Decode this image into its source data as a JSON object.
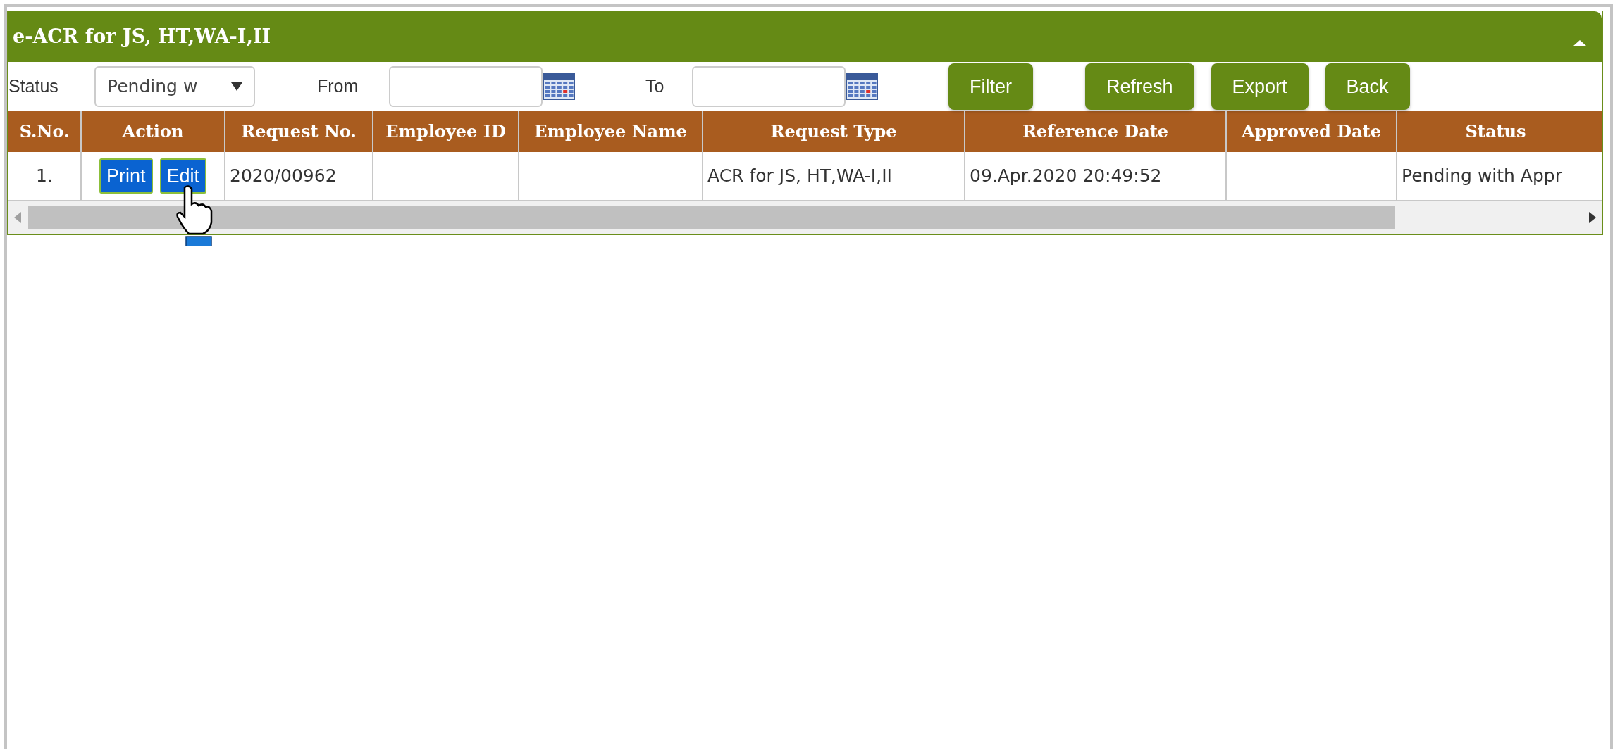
{
  "panel": {
    "title": "e-ACR for JS, HT,WA-I,II"
  },
  "filters": {
    "status_label": "Status",
    "status_value": "Pending w",
    "from_label": "From",
    "to_label": "To"
  },
  "buttons": [
    "Filter",
    "Refresh",
    "Export",
    "Back"
  ],
  "table": {
    "columns": [
      "S.No.",
      "Action",
      "Request No.",
      "Employee ID",
      "Employee Name",
      "Request Type",
      "Reference Date",
      "Approved Date",
      "Status"
    ],
    "rows": [
      {
        "sno": "1.",
        "actions": [
          "Print",
          "Edit"
        ],
        "request_no": "2020/00962",
        "employee_id": "",
        "employee_name": "",
        "request_type": "ACR for JS, HT,WA-I,II",
        "reference_date": "09.Apr.2020 20:49:52",
        "approved_date": "",
        "status": "Pending with Appr"
      }
    ]
  }
}
